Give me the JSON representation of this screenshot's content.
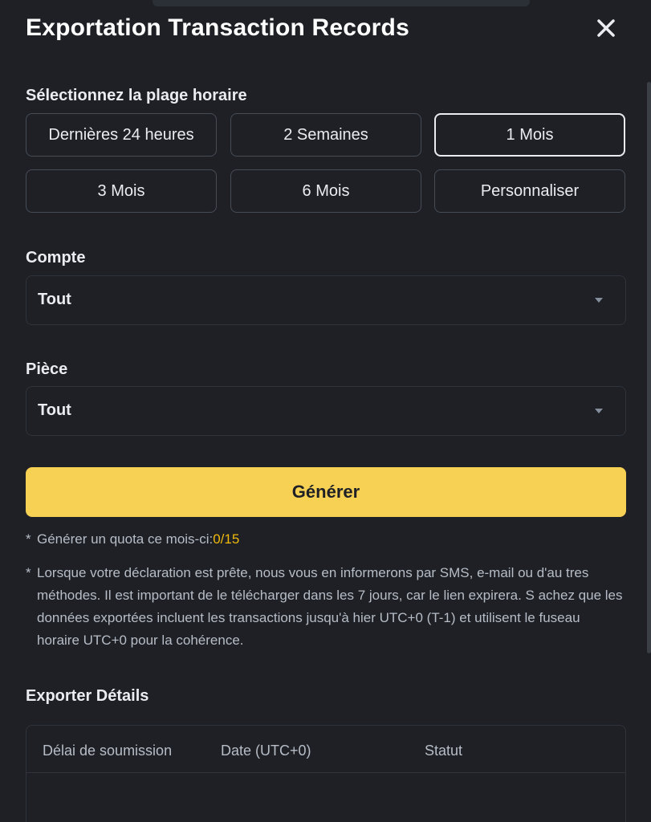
{
  "modal": {
    "title": "Exportation Transaction Records",
    "close_icon": "close-icon"
  },
  "time_range": {
    "label": "Sélectionnez la plage horaire",
    "options": [
      {
        "label": "Dernières 24 heures",
        "selected": false
      },
      {
        "label": "2 Semaines",
        "selected": false
      },
      {
        "label": "1 Mois",
        "selected": true
      },
      {
        "label": "3 Mois",
        "selected": false
      },
      {
        "label": "6 Mois",
        "selected": false
      },
      {
        "label": "Personnaliser",
        "selected": false
      }
    ]
  },
  "account": {
    "label": "Compte",
    "value": "Tout",
    "icon": "chevron-down-icon"
  },
  "coin": {
    "label": "Pièce",
    "value": "Tout",
    "icon": "chevron-down-icon"
  },
  "generate": {
    "label": "Générer",
    "color": "#f7d154"
  },
  "notes": {
    "star": "*",
    "quota_text": "Générer un quota ce mois-ci:",
    "quota_value": "0/15",
    "quota_color": "#f0b90b",
    "info": "Lorsque votre déclaration est prête, nous vous en informerons par SMS, e-mail ou d'au tres méthodes. Il est important de le télécharger dans les 7 jours, car le lien expirera. S achez que les données exportées incluent les transactions jusqu'à hier UTC+0 (T-1) et utilisent le fuseau horaire UTC+0 pour la cohérence."
  },
  "export_details": {
    "label": "Exporter Détails",
    "columns": [
      "Délai de soumission",
      "Date (UTC+0)",
      "Statut"
    ]
  }
}
